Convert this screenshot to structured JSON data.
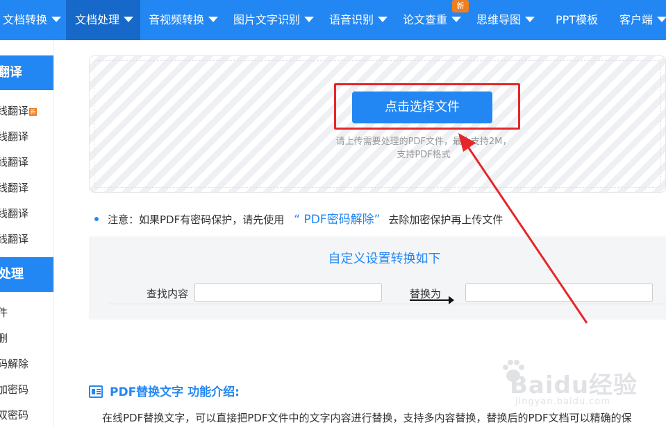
{
  "colors": {
    "brand": "#2387f3",
    "brand_dark": "#1769c9",
    "highlight": "#e5262a",
    "badge": "#f07d1f"
  },
  "nav": {
    "items": [
      {
        "label": "文档转换",
        "has_caret": true
      },
      {
        "label": "文档处理",
        "has_caret": true,
        "active": true
      },
      {
        "label": "音视频转换",
        "has_caret": true
      },
      {
        "label": "图片文字识别",
        "has_caret": true
      },
      {
        "label": "语音识别",
        "has_caret": true
      },
      {
        "label": "论文查重",
        "has_caret": true,
        "badge": "新"
      },
      {
        "label": "思维导图",
        "has_caret": true
      },
      {
        "label": "PPT模板",
        "has_caret": false
      },
      {
        "label": "客户端",
        "has_caret": true
      }
    ]
  },
  "sidebar": {
    "translate_heading": "翻译",
    "translate_items": [
      "线翻译",
      "线翻译",
      "线翻译",
      "线翻译",
      "线翻译",
      "线翻译"
    ],
    "translate_hot_badge": "新",
    "process_heading": "处理",
    "process_items": [
      "件",
      "删",
      "码解除",
      "加密码",
      "双密码"
    ]
  },
  "upload": {
    "button_label": "点击选择文件",
    "hint_line1": "请上传需要处理的PDF文件，最大支持2M，",
    "hint_line2": "支持PDF格式"
  },
  "notice": {
    "prefix": "注意：如果PDF有密码保护，请先使用",
    "link": "“ PDF密码解除”",
    "suffix": "去除加密保护再上传文件"
  },
  "settings": {
    "title": "自定义设置转换如下",
    "find_label": "查找内容",
    "find_value": "",
    "replace_label": "替换为",
    "replace_value": ""
  },
  "intro": {
    "title": "PDF替换文字 功能介绍:",
    "text": "在线PDF替换文字，可以直接把PDF文件中的文字内容进行替换，支持多内容替换，替换后的PDF文档可以精确的保"
  },
  "watermark": {
    "logo": "Baidu经验",
    "url": "jingyan.baidu.com"
  }
}
